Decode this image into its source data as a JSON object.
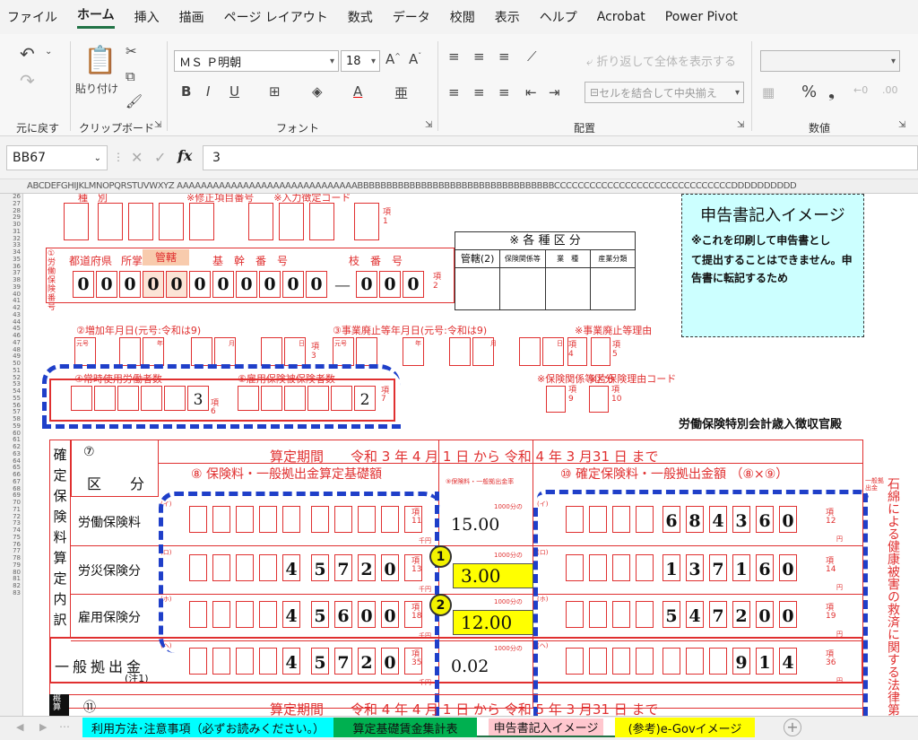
{
  "menu": {
    "items": [
      "ファイル",
      "ホーム",
      "挿入",
      "描画",
      "ページ レイアウト",
      "数式",
      "データ",
      "校閲",
      "表示",
      "ヘルプ",
      "Acrobat",
      "Power Pivot"
    ],
    "active": "ホーム"
  },
  "ribbon": {
    "undo_group": "元に戻す",
    "paste": "貼り付け",
    "clipboard_group": "クリップボード",
    "font_name": "ＭＳ Ｐ明朝",
    "font_size": "18",
    "font_group": "フォント",
    "wrap_text": "折り返して全体を表示する",
    "merge_center": "セルを結合して中央揃え",
    "alignment_group": "配置",
    "number_group": "数値"
  },
  "formula_bar": {
    "name_box": "BB67",
    "fx": "fx",
    "value": "3"
  },
  "column_header": "ABCDEFGHIJKLMNOPQRSTUVWXYZ AAAAAAAAAAAAAAAAAAAAAAAAAAAAAABBBBBBBBBBBBBBBBBBBBBBBBBBBBBBBBBBCCCCCCCCCCCCCCCCCCCCCCCCCCCCCCDDDDDDDDDD",
  "row_numbers": [
    "26",
    "27",
    "28",
    "29",
    "30",
    "31",
    "32",
    "33",
    "34",
    "35",
    "36",
    "37",
    "38",
    "39",
    "40",
    "41",
    "42",
    "43",
    "44",
    "45",
    "46",
    "47",
    "48",
    "49",
    "50",
    "51",
    "52",
    "53",
    "54",
    "55",
    "56",
    "57",
    "58",
    "59",
    "60",
    "61",
    "62",
    "63",
    "64",
    "65",
    "66",
    "67",
    "68",
    "69",
    "70",
    "71",
    "72",
    "73",
    "74",
    "75",
    "76",
    "77",
    "78",
    "79",
    "80",
    "81",
    "82",
    "83"
  ],
  "form": {
    "top_fragment": "種　別　　　　　　　　※修正項目番号　　※入力徴定コード",
    "kou1": "項1",
    "labor_ins_label": "①労働保険番号",
    "headers": {
      "pref": "都道府県",
      "office": "所掌",
      "jurisdiction": "管轄",
      "base": "基　幹　番　号",
      "branch": "枝　番　号"
    },
    "number_digits": [
      "0",
      "0",
      "0",
      "0",
      "0",
      "0",
      "0",
      "0",
      "0",
      "0",
      "0",
      "0",
      "0",
      "0"
    ],
    "kou2": "項2",
    "category_title": "※ 各 種 区 分",
    "category_cols": [
      "管轄(2)",
      "保険関係等",
      "業　種",
      "産業分類"
    ],
    "increase_date": "②増加年月日(元号:令和は9)",
    "abolish_date": "③事業廃止等年月日(元号:令和は9)",
    "abolish_reason": "※事業廃止等理由",
    "era": "元号",
    "year": "年",
    "month": "月",
    "day": "日",
    "kou3": "項3",
    "kou4": "項4",
    "kou5": "項5",
    "workers_label": "④常時使用労働者数",
    "workers_value": "3",
    "insured_label": "⑤雇用保険被保険者数",
    "insured_value": "2",
    "kou6": "項6",
    "kou7": "項7",
    "ins_relation": "※保険関係等区分",
    "tax_code": "※片保険理由コード",
    "kou9": "項9",
    "kou10": "項10",
    "office_name": "労働保険特別会計歳入徴収官殿",
    "kakutei": "確定保険料算定内訳",
    "section7": "⑦",
    "kubun": "区　　分",
    "period": "算定期間　　令和 3 年 4 月 1 日 から 令和 4 年 3 月31 日 まで",
    "base8": "⑧ 保険料・一般拠出金算定基礎額",
    "rate9": "⑨保険料・一般拠出金率",
    "amount10": "⑩ 確定保険料・一般拠出金額 （⑧×⑨）",
    "per_1000": "1000分の",
    "thousand_yen": "千円",
    "yen": "円",
    "rows": [
      {
        "label": "労働保険料",
        "mark": "(イ)",
        "base": [
          "",
          "",
          "",
          "",
          "",
          "",
          "",
          "",
          "",
          ""
        ],
        "rate": "15.00",
        "rate_highlight": false,
        "amount": [
          "",
          "",
          "",
          "",
          "6",
          "8",
          "4",
          "3",
          "6",
          "0"
        ],
        "kou_a": "項11",
        "kou_b": "項12"
      },
      {
        "label": "労災保険分",
        "mark": "(ロ)",
        "base": [
          "",
          "",
          "",
          "",
          "4",
          "5",
          "7",
          "2",
          "0",
          ""
        ],
        "rate": "3.00",
        "rate_highlight": true,
        "amount": [
          "",
          "",
          "",
          "",
          "1",
          "3",
          "7",
          "1",
          "6",
          "0"
        ],
        "kou_a": "項13",
        "kou_b": "項14"
      },
      {
        "label": "雇用保険分",
        "mark": "(ホ)",
        "base": [
          "",
          "",
          "",
          "",
          "4",
          "5",
          "6",
          "0",
          "0",
          ""
        ],
        "rate": "12.00",
        "rate_highlight": true,
        "amount": [
          "",
          "",
          "",
          "",
          "5",
          "4",
          "7",
          "2",
          "0",
          "0"
        ],
        "kou_a": "項18",
        "kou_b": "項19"
      },
      {
        "label": "一般拠出金",
        "note": "(注1)",
        "mark": "(ヘ)",
        "base": [
          "",
          "",
          "",
          "",
          "4",
          "5",
          "7",
          "2",
          "0",
          ""
        ],
        "rate": "0.02",
        "rate_highlight": false,
        "amount": [
          "",
          "",
          "",
          "",
          "",
          "",
          "",
          "9",
          "1",
          "4"
        ],
        "kou_a": "項35",
        "kou_b": "項36"
      }
    ],
    "circle1": "1",
    "circle2": "2",
    "asbestos": "石綿による健康被害の救済に関する法律第",
    "asbestos_head": "一般拠出金",
    "bottom_section": "⑪",
    "bottom_period": "算定期間　　令和 4 年 4 月 1 日 から 令和 5 年 3 月31 日 まで",
    "bottom_side": "概算"
  },
  "image_box": {
    "title": "申告書記入イメージ",
    "lines": [
      "※これを印刷して申告書とし",
      "て提出することはできません。申告書に転記するため"
    ]
  },
  "tabs": [
    {
      "label": "利用方法･注意事項（必ずお読みください。）",
      "color": "#00ffff"
    },
    {
      "label": "算定基礎賃金集計表",
      "color": "#00b050"
    },
    {
      "label": "申告書記入イメージ",
      "color": "#ffc7ce"
    },
    {
      "label": "(参考)e-Govイメージ",
      "color": "#ffff00"
    }
  ],
  "add_sheet": "+"
}
